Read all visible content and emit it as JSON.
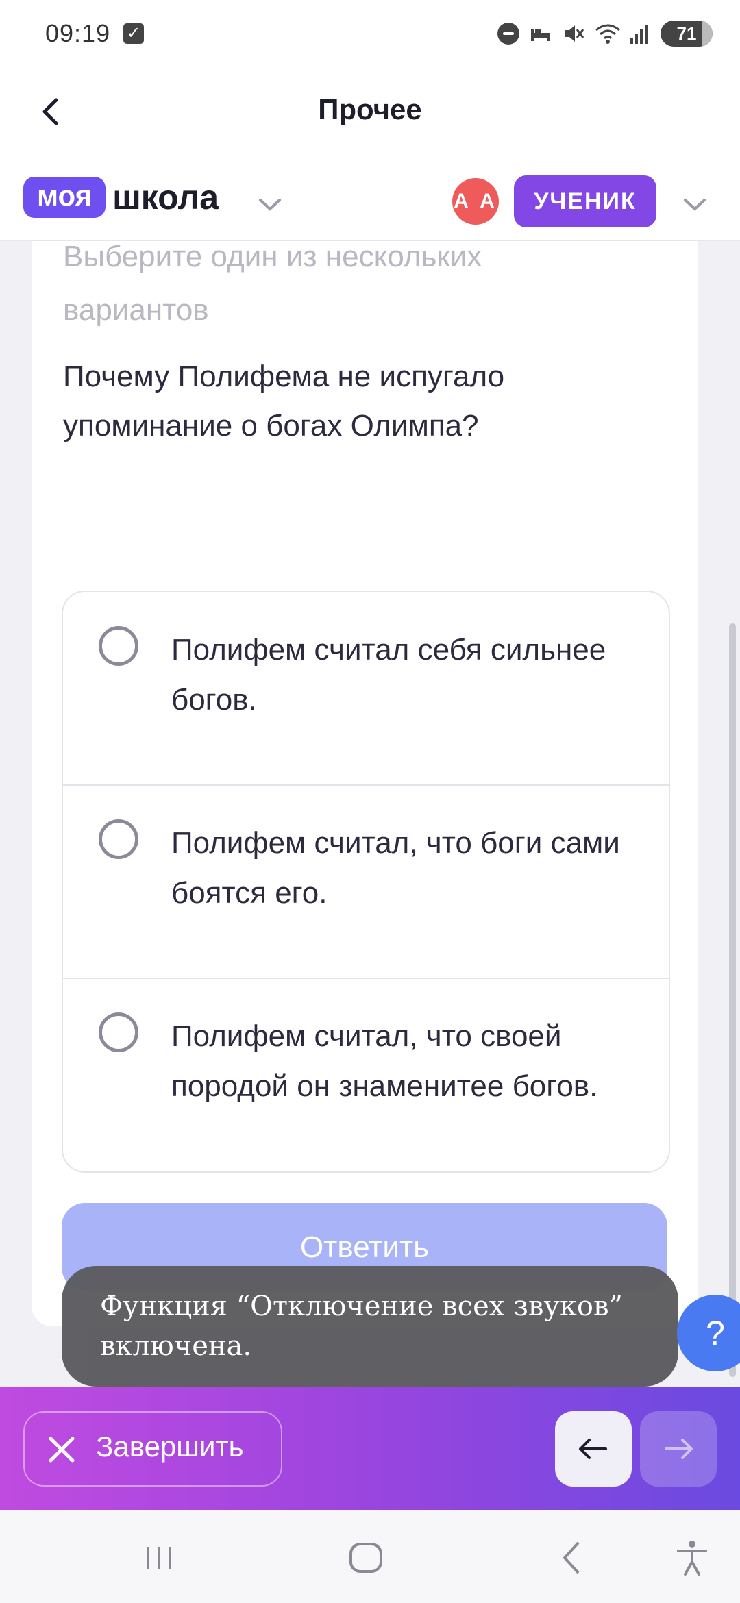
{
  "status_bar": {
    "time": "09:19",
    "battery": "71",
    "icons": [
      "check-icon",
      "dnd-icon",
      "sleep-icon",
      "mute-icon",
      "wifi-icon",
      "signal-icon",
      "battery-icon"
    ]
  },
  "header": {
    "title": "Прочее",
    "logo_part1": "моя",
    "logo_part2": "школа",
    "avatar_initials": "А А",
    "role": "УЧЕНИК"
  },
  "quiz": {
    "instruction": "Выберите один из нескольких вариантов",
    "question": "Почему Полифема не испугало упоминание о богах Олимпа?",
    "options": [
      "Полифем считал себя сильнее богов.",
      "Полифем считал, что боги сами боятся его.",
      "Полифем считал, что своей породой он знаменитее богов."
    ],
    "answer_button": "Ответить"
  },
  "toast": {
    "text": "Функция “Отключение всех звуков” включена."
  },
  "help_button": "?",
  "bottom_bar": {
    "finish_label": "Завершить"
  },
  "colors": {
    "brand": "#6f4ff0",
    "role_badge": "#8247e5",
    "answer_disabled": "#a8b3f8",
    "help": "#4a7af2"
  }
}
